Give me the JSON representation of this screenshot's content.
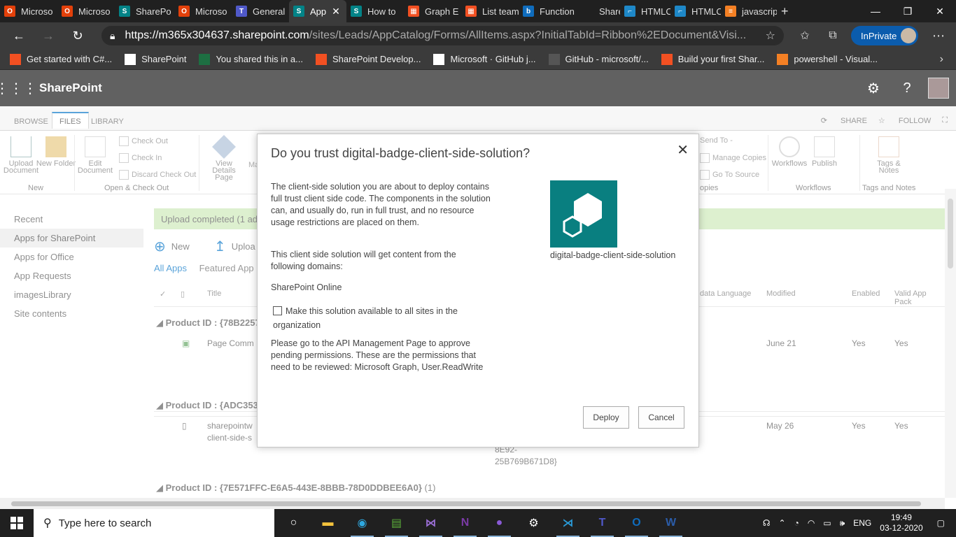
{
  "browser": {
    "tabs": [
      {
        "label": "Microso",
        "color": "#e3400a",
        "glyph": "O"
      },
      {
        "label": "Microso",
        "color": "#e3400a",
        "glyph": "O"
      },
      {
        "label": "SharePo",
        "color": "#038387",
        "glyph": "S"
      },
      {
        "label": "Microso",
        "color": "#e3400a",
        "glyph": "O"
      },
      {
        "label": "General",
        "color": "#5059c9",
        "glyph": "T"
      },
      {
        "label": "App",
        "color": "#038387",
        "glyph": "S"
      },
      {
        "label": "How to",
        "color": "#038387",
        "glyph": "S"
      },
      {
        "label": "Graph E",
        "color": "#f25022",
        "glyph": "▦"
      },
      {
        "label": "List team",
        "color": "#f25022",
        "glyph": "▦"
      },
      {
        "label": "Function",
        "color": "#0f6cbd",
        "glyph": "b"
      },
      {
        "label": "SharePo",
        "color": "#202020",
        "glyph": ""
      },
      {
        "label": "HTMLCa",
        "color": "#1e88c8",
        "glyph": "⌐"
      },
      {
        "label": "HTMLCa",
        "color": "#1e88c8",
        "glyph": "⌐"
      },
      {
        "label": "javascrip",
        "color": "#f48024",
        "glyph": "≡"
      }
    ],
    "active_tab_index": 5,
    "url_host": "https://m365x304637.sharepoint.com",
    "url_path": "/sites/Leads/AppCatalog/Forms/AllItems.aspx?InitialTabId=Ribbon%2EDocument&Visi...",
    "inprivate_label": "InPrivate",
    "favorites": [
      {
        "label": "Get started with C#...",
        "color": "#f25022"
      },
      {
        "label": "SharePoint",
        "color": "#ffffff"
      },
      {
        "label": "You shared this in a...",
        "color": "#1d6f42"
      },
      {
        "label": "SharePoint Develop...",
        "color": "#f25022"
      },
      {
        "label": "Microsoft · GitHub j...",
        "color": "#ffffff"
      },
      {
        "label": "GitHub - microsoft/...",
        "color": "#555555"
      },
      {
        "label": "Build your first Shar...",
        "color": "#f25022"
      },
      {
        "label": "powershell - Visual...",
        "color": "#f48024"
      }
    ]
  },
  "sharepoint": {
    "suite_title": "SharePoint",
    "ribbon_tabs": [
      "BROWSE",
      "FILES",
      "LIBRARY"
    ],
    "ribbon_share": "SHARE",
    "ribbon_follow": "FOLLOW",
    "ribbon": {
      "upload_document": "Upload Document",
      "new_folder": "New Folder",
      "edit_document": "Edit Document",
      "check_out": "Check Out",
      "check_in": "Check In",
      "discard_check_out": "Discard Check Out",
      "view_details_page": "View Details Page",
      "ma": "Ma",
      "send_to": "Send To -",
      "manage_copies": "Manage Copies",
      "go_to_source": "Go To Source",
      "workflows": "Workflows",
      "publish": "Publish",
      "tags_notes": "Tags & Notes",
      "group_new": "New",
      "group_open_checkout": "Open & Check Out",
      "group_copies": "opies",
      "group_workflows": "Workflows",
      "group_tags": "Tags and Notes"
    },
    "leftnav": [
      "Recent",
      "Apps for SharePoint",
      "Apps for Office",
      "App Requests",
      "imagesLibrary",
      "Site contents"
    ],
    "leftnav_selected": 1,
    "banner": "Upload completed (1 ad",
    "cmd_new": "New",
    "cmd_upload": "Uploa",
    "views": [
      "All Apps",
      "Featured App"
    ],
    "columns": {
      "title": "Title",
      "metadata_language": "data Language",
      "modified": "Modified",
      "enabled": "Enabled",
      "valid": "Valid App Pack"
    },
    "groups": [
      {
        "label": "Product ID : {78B2257",
        "title": "Page Comm",
        "modified": "June 21",
        "enabled": "Yes",
        "valid": "Yes"
      },
      {
        "label": "Product ID : {ADC353",
        "title": "sharepointw",
        "title2": "client-side-s",
        "extra1": "8E92-",
        "extra2": "25B769B671D8}",
        "modified": "May 26",
        "enabled": "Yes",
        "valid": "Yes"
      },
      {
        "label": "Product ID : {7E571FFC-E6A5-443E-8BBB-78D0DDBEE6A0}",
        "count": "(1)"
      }
    ]
  },
  "dialog": {
    "title": "Do you trust digital-badge-client-side-solution?",
    "para1": "The client-side solution you are about to deploy contains full trust client side code. The components in the solution can, and usually do, run in full trust, and no resource usage restrictions are placed on them.",
    "para2": "This client side solution will get content from the following domains:",
    "domain": "SharePoint Online",
    "checkbox_label": "Make this solution available to all sites in the organization",
    "checkbox_checked": false,
    "para3": "Please go to the API Management Page to approve pending permissions. These are the permissions that need to be reviewed: Microsoft Graph, User.ReadWrite",
    "app_name": "digital-badge-client-side-solution",
    "app_color": "#097f80",
    "deploy_label": "Deploy",
    "cancel_label": "Cancel"
  },
  "taskbar": {
    "search_placeholder": "Type here to search",
    "lang": "ENG",
    "time": "19:49",
    "date": "03-12-2020",
    "apps": [
      {
        "name": "cortana-icon",
        "glyph": "○",
        "color": "#ffffff"
      },
      {
        "name": "file-explorer-icon",
        "glyph": "▬",
        "color": "#f3c23c"
      },
      {
        "name": "edge-icon",
        "glyph": "◉",
        "color": "#2ea8e0"
      },
      {
        "name": "chart-app-icon",
        "glyph": "▤",
        "color": "#5bae3a"
      },
      {
        "name": "visual-studio-icon",
        "glyph": "⋈",
        "color": "#9b6fd6"
      },
      {
        "name": "onenote-icon",
        "glyph": "N",
        "color": "#7b3aa6"
      },
      {
        "name": "github-desktop-icon",
        "glyph": "●",
        "color": "#8a5ad6"
      },
      {
        "name": "settings-icon",
        "glyph": "⚙",
        "color": "#ffffff"
      },
      {
        "name": "vscode-icon",
        "glyph": "⋊",
        "color": "#2a9bd8"
      },
      {
        "name": "teams-icon",
        "glyph": "T",
        "color": "#5059c9"
      },
      {
        "name": "outlook-icon",
        "glyph": "O",
        "color": "#0f6cbd"
      },
      {
        "name": "word-icon",
        "glyph": "W",
        "color": "#2b5ca8"
      }
    ]
  }
}
